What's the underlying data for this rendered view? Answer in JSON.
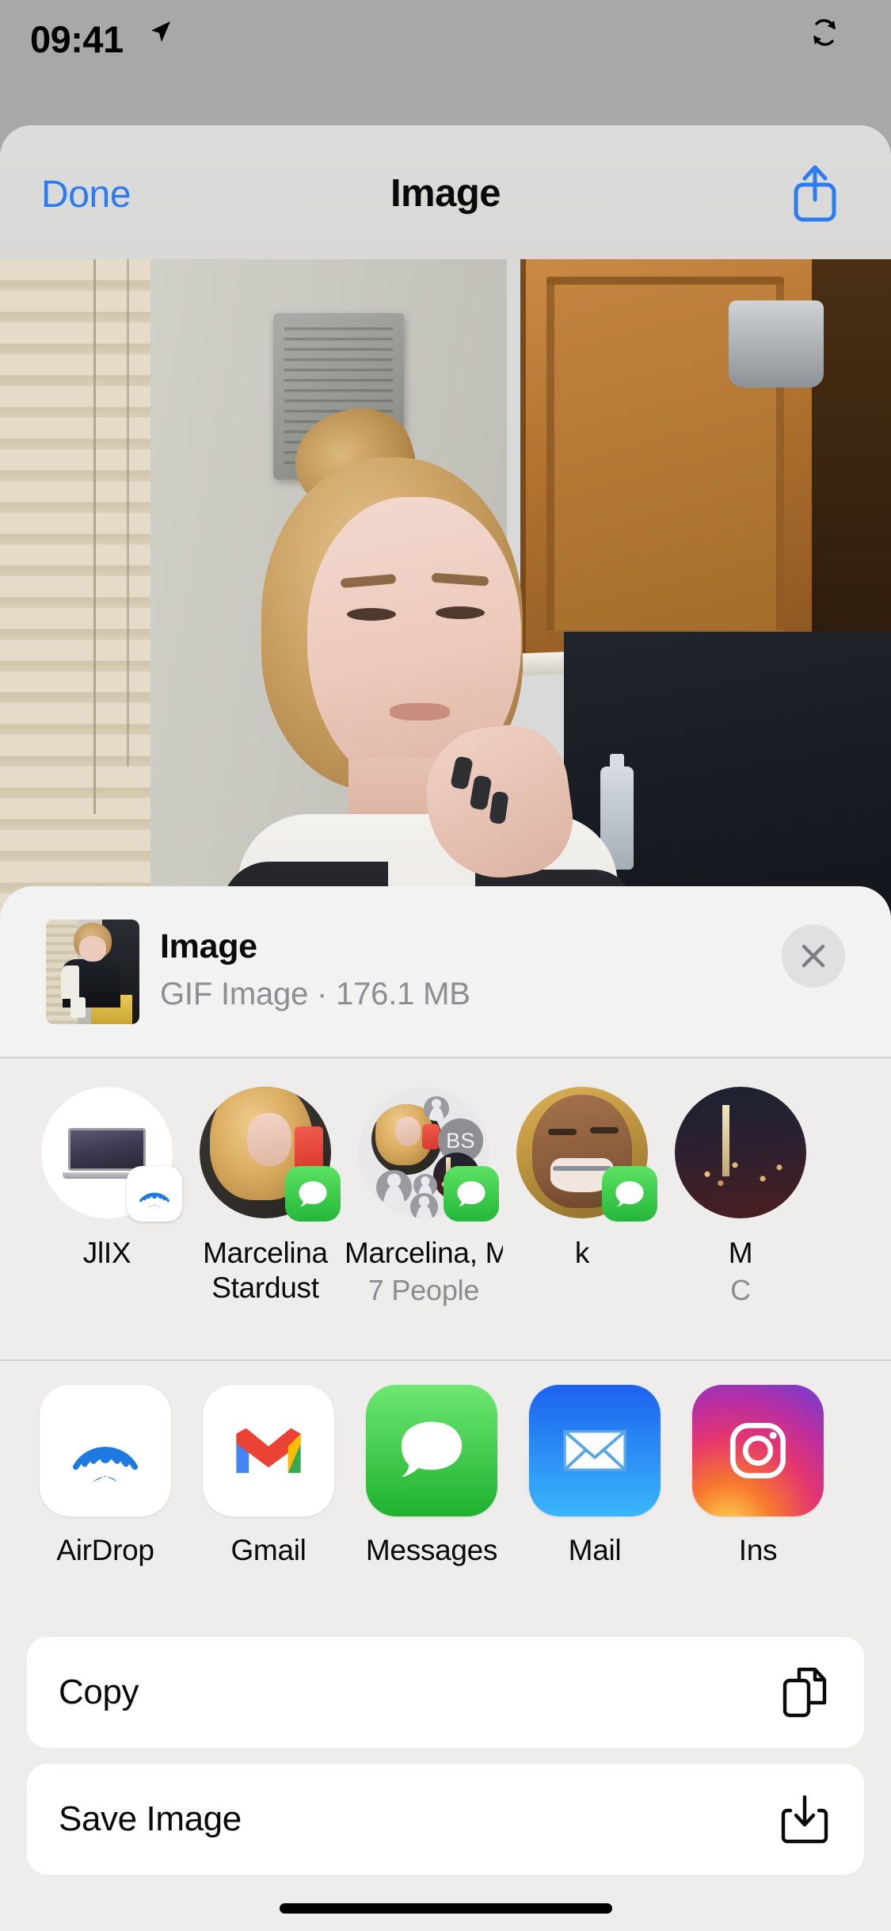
{
  "status_bar": {
    "time": "09:41",
    "location_icon": "location-arrow-icon",
    "right_icon": "sync-rotate-icon"
  },
  "nav_bar": {
    "done_label": "Done",
    "title": "Image",
    "share_icon": "share-up-arrow-icon"
  },
  "share_sheet": {
    "file": {
      "title": "Image",
      "subtitle": "GIF Image · 176.1 MB",
      "thumbnail_alt": "image-thumbnail",
      "close_icon": "close-x-icon"
    },
    "contacts": [
      {
        "name": "JlIX",
        "subtitle": "",
        "avatar_type": "macbook",
        "badge": "airdrop-badge"
      },
      {
        "name": "Marcelina Stardust",
        "subtitle": "",
        "avatar_type": "photo-woman",
        "badge": "messages-badge"
      },
      {
        "name": "Marcelina, Mic...",
        "subtitle": "7 People",
        "avatar_type": "group",
        "badge": "messages-badge",
        "group_initials": "BS"
      },
      {
        "name": "k",
        "subtitle": "",
        "avatar_type": "photo-person",
        "badge": "messages-badge"
      },
      {
        "name": "M",
        "subtitle": "C",
        "avatar_type": "photo-city",
        "badge": ""
      }
    ],
    "apps": [
      {
        "name": "AirDrop",
        "icon": "airdrop-icon"
      },
      {
        "name": "Gmail",
        "icon": "gmail-icon"
      },
      {
        "name": "Messages",
        "icon": "messages-icon"
      },
      {
        "name": "Mail",
        "icon": "mail-icon"
      },
      {
        "name": "Ins",
        "icon": "instagram-icon"
      }
    ],
    "actions": [
      {
        "label": "Copy",
        "icon": "copy-documents-icon"
      },
      {
        "label": "Save Image",
        "icon": "save-download-icon"
      }
    ]
  },
  "colors": {
    "accent_blue": "#2b7cf0",
    "messages_green": "#25b73a",
    "sheet_bg": "#eeedec",
    "card_white": "#ffffff",
    "secondary_text": "#8d8d92",
    "backdrop_gray": "#a8a8a8"
  }
}
